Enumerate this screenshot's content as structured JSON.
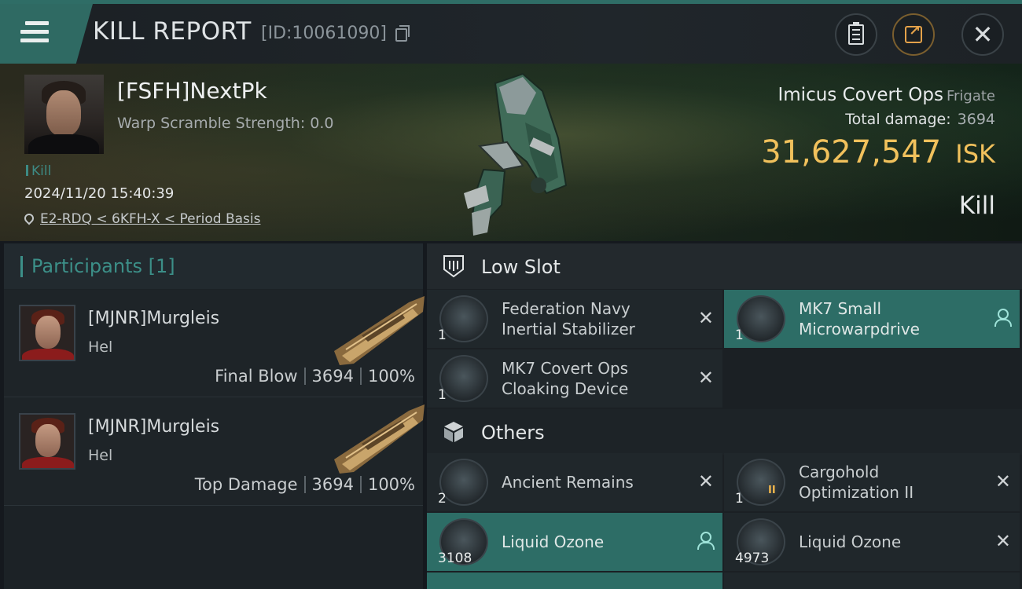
{
  "header": {
    "title": "KILL REPORT",
    "report_id": "[ID:10061090]"
  },
  "victim": {
    "name": "[FSFH]NextPk",
    "warp_scramble": "Warp Scramble Strength: 0.0",
    "tag": "Kill",
    "datetime": "2024/11/20 15:40:39",
    "location": "E2-RDQ < 6KFH-X < Period Basis",
    "ship_name": "Imicus Covert Ops",
    "ship_class": "Frigate",
    "total_damage_label": "Total damage:",
    "total_damage": "3694",
    "isk_value": "31,627,547",
    "isk_unit": "ISK",
    "result": "Kill"
  },
  "participants": {
    "title": "Participants [1]",
    "rows": [
      {
        "name": "[MJNR]Murgleis",
        "ship": "Hel",
        "role": "Final Blow",
        "damage": "3694",
        "percent": "100%"
      },
      {
        "name": "[MJNR]Murgleis",
        "ship": "Hel",
        "role": "Top Damage",
        "damage": "3694",
        "percent": "100%"
      }
    ]
  },
  "sections": {
    "low_slot": "Low Slot",
    "others": "Others"
  },
  "items": {
    "low": [
      {
        "name": "Federation Navy Inertial Stabilizer",
        "qty": "1",
        "status": "destroyed",
        "icon": "stabilizer-icon"
      },
      {
        "name": "MK7 Small Microwarpdrive",
        "qty": "1",
        "status": "dropped",
        "icon": "microwarpdrive-icon"
      },
      {
        "name": "MK7 Covert Ops Cloaking Device",
        "qty": "1",
        "status": "destroyed",
        "icon": "cloak-icon"
      }
    ],
    "others": [
      {
        "name": "Ancient Remains",
        "qty": "2",
        "status": "destroyed",
        "icon": "remains-icon"
      },
      {
        "name": "Cargohold Optimization II",
        "qty": "1",
        "status": "destroyed",
        "icon": "cargohold-icon",
        "tier": "II"
      },
      {
        "name": "Liquid Ozone",
        "qty": "3108",
        "status": "dropped",
        "icon": "ozone-icon"
      },
      {
        "name": "Liquid Ozone",
        "qty": "4973",
        "status": "destroyed",
        "icon": "ozone-icon"
      }
    ]
  },
  "colors": {
    "accent": "#3c8f88",
    "highlight": "#2d6d66",
    "isk": "#f1c15c"
  }
}
